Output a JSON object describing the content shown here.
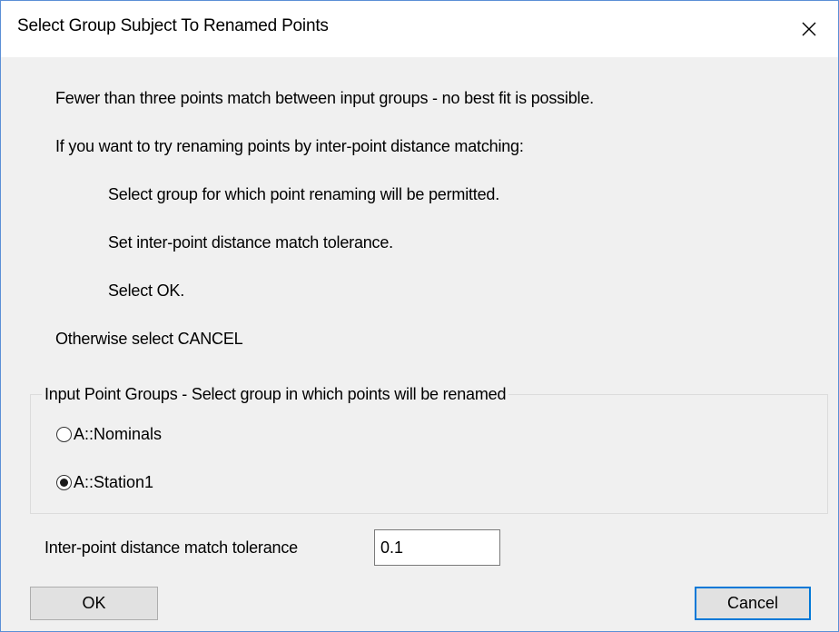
{
  "dialog": {
    "title": "Select Group Subject To Renamed Points",
    "close_symbol": "×"
  },
  "messages": {
    "line1": "Fewer than three points match between input groups - no best fit is possible.",
    "line2": "If you want to try renaming points by inter-point distance matching:",
    "step1": "Select group for which point renaming will be permitted.",
    "step2": "Set inter-point distance match tolerance.",
    "step3": "Select OK.",
    "line3": "Otherwise select CANCEL"
  },
  "groups": {
    "legend": "Input Point Groups - Select group in which points will be renamed",
    "options": [
      {
        "label": "A::Nominals",
        "selected": false
      },
      {
        "label": "A::Station1",
        "selected": true
      }
    ]
  },
  "tolerance": {
    "label": "Inter-point distance match tolerance",
    "value": "0.1"
  },
  "buttons": {
    "ok": "OK",
    "cancel": "Cancel"
  },
  "colors": {
    "window_border": "#5b8fd6",
    "dialog_bg": "#f0f0f0",
    "default_button_border": "#0078d7"
  },
  "icons": {
    "close": "close-icon"
  }
}
